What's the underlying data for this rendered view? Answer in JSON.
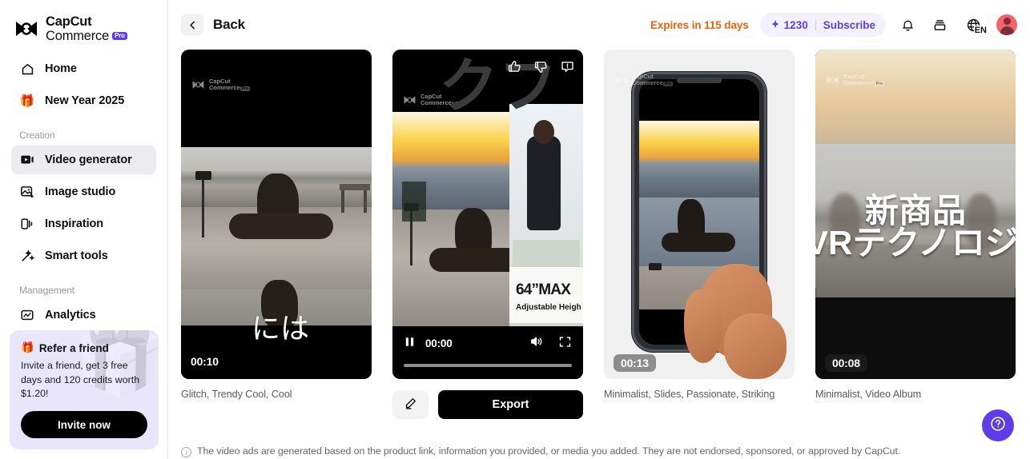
{
  "sidebar": {
    "brand": {
      "line1": "CapCut",
      "line2": "Commerce",
      "badge": "Pro"
    },
    "items": [
      {
        "label": "Home",
        "icon": "home-icon"
      },
      {
        "label": "New Year 2025",
        "icon": "gift-emoji"
      }
    ],
    "creation_label": "Creation",
    "creation_items": [
      {
        "label": "Video generator",
        "icon": "video-generator-icon",
        "active": true
      },
      {
        "label": "Image studio",
        "icon": "image-studio-icon",
        "active": false
      },
      {
        "label": "Inspiration",
        "icon": "inspiration-icon",
        "active": false
      },
      {
        "label": "Smart tools",
        "icon": "smart-tools-icon",
        "active": false
      }
    ],
    "management_label": "Management",
    "management_items": [
      {
        "label": "Analytics",
        "icon": "analytics-icon",
        "active": false
      }
    ],
    "refer": {
      "emoji": "🎁",
      "title": "Refer a friend",
      "description": "Invite a friend, get 3 free days and 120 credits worth $1.20!",
      "button": "Invite now"
    }
  },
  "header": {
    "back_label": "Back",
    "expires": "Expires in 115 days",
    "credits": "1230",
    "subscribe": "Subscribe",
    "language": "EN"
  },
  "cards": [
    {
      "duration": "00:10",
      "caption": "Glitch, Trendy Cool, Cool",
      "overlay_text": "には",
      "selected": false
    },
    {
      "duration": "00:00",
      "caption": "",
      "overlay_text": "クフ",
      "badge_big": "64”MAX",
      "badge_sub": "Adjustable Heigh",
      "selected": true
    },
    {
      "duration": "00:13",
      "caption": "Minimalist, Slides, Passionate, Striking",
      "overlay_text": "",
      "selected": false
    },
    {
      "duration": "00:08",
      "caption": "Minimalist, Video Album",
      "overlay_text": "新商品",
      "overlay_text2": "VRテクノロジー",
      "selected": false
    }
  ],
  "player": {
    "time": "00:00",
    "edit_label": "",
    "export_label": "Export"
  },
  "watermark": {
    "line1": "CapCut",
    "line2": "Commerce",
    "badge": "Pro"
  },
  "footer": {
    "note": "The video ads are generated based on the product link, information you provided, or media you added. They are not endorsed, sponsored, or approved by CapCut."
  },
  "colors": {
    "accent": "#5c3ee8",
    "warning": "#f5620a",
    "pill_bg": "#f3f1fd",
    "refer_bg": "#e9e6fb"
  }
}
